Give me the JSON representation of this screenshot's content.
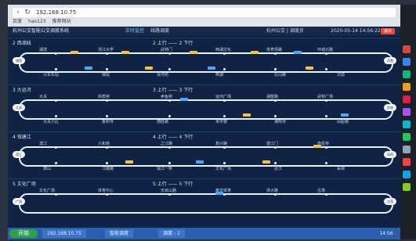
{
  "browser": {
    "url": "192.168.10.75",
    "bookmarks": [
      "百度",
      "hao123",
      "推荐网站"
    ]
  },
  "header": {
    "title": "杭州公交智能公交调度系统",
    "tab1": "实时监控",
    "tab2": "线路调度",
    "account": "杭州公交 | 调度员",
    "time": "2020-05-14 14:56:22",
    "logout": "退出"
  },
  "routes": [
    {
      "name": "2 西湖线",
      "name2": "2 上行 —— 2 下行",
      "stops_top": [
        "湖滨",
        "浙江大学",
        "武林门",
        "西湖文化",
        "体育场路",
        "环城北路"
      ],
      "stops_bot": [
        "火车东站",
        "城站",
        "清河坊",
        "西湖",
        "北山路",
        "灵隐"
      ],
      "endL": "湖滨",
      "endR": "灵隐"
    },
    {
      "name": "3 大运河",
      "name2": "3 上行 —— 3 下行",
      "stops_top": [
        "大关",
        "拱宸桥",
        "卖鱼桥",
        "运河广场",
        "湖墅路",
        "武林广场"
      ],
      "stops_bot": [
        "大关小区",
        "香积寺",
        "德胜路",
        "米市巷",
        "潮鸣寺",
        "凤起路"
      ],
      "endL": "大关",
      "endR": "武林"
    },
    {
      "name": "4 钱塘江",
      "name2": "4 上行 —— 4 下行",
      "stops_top": [
        "滨江",
        "六和塔",
        "之江路",
        "复兴路",
        "望江门",
        "南星桥"
      ],
      "stops_bot": [
        "萧山",
        "江陵路",
        "钱江一桥",
        "文化广场",
        "近江",
        "采荷"
      ],
      "endL": "滨江",
      "endR": "采荷"
    },
    {
      "name": "5 文化广场",
      "name2": "5 上行 —— 5 下行",
      "stops_top": [
        "文化广场",
        "体育中心",
        "天目山路",
        "黄龙体育",
        "浙大路",
        "古荡"
      ],
      "stops_bot": [],
      "endL": "广场",
      "endR": "古荡"
    }
  ],
  "taskbar": {
    "start": "开始",
    "tasks": [
      "192.168.10.75",
      "智能调度",
      "调度 - 1"
    ],
    "time": "14:56"
  },
  "colors": {
    "bus_yellow": "#f3c43c",
    "bus_blue": "#47a9ff"
  }
}
